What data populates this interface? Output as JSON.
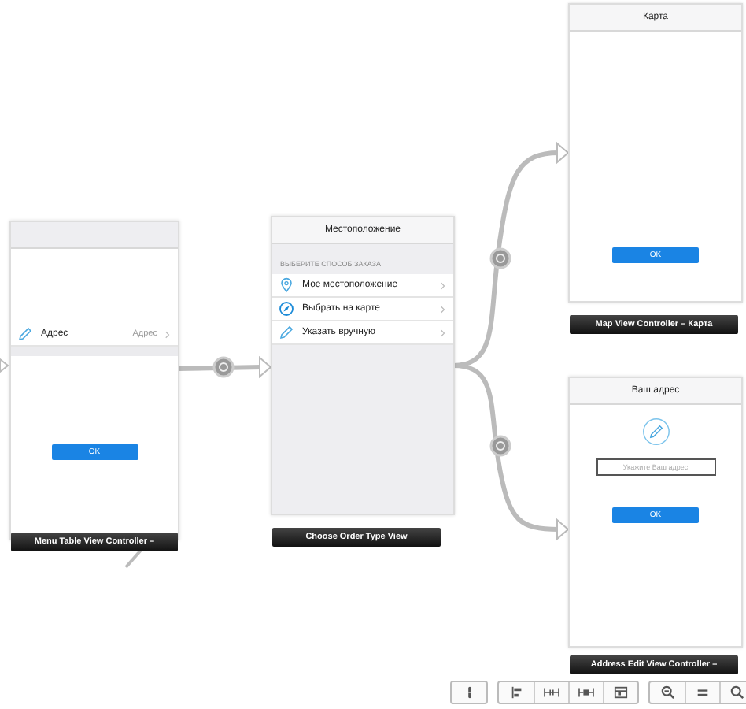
{
  "menu_scene": {
    "rows": [
      {
        "label": "Адрес",
        "detail": "Адрес"
      }
    ],
    "button": "OK",
    "caption": "Menu Table View Controller –"
  },
  "order_scene": {
    "title": "Местоположение",
    "section": "ВЫБЕРИТЕ СПОСОБ ЗАКАЗА",
    "rows": [
      {
        "label": "Мое местоположение"
      },
      {
        "label": "Выбрать на карте"
      },
      {
        "label": "Указать вручную"
      }
    ],
    "caption": "Choose Order Type View"
  },
  "map_scene": {
    "title": "Карта",
    "button": "OK",
    "caption": "Map View Controller – Карта"
  },
  "address_scene": {
    "title": "Ваш адрес",
    "placeholder": "Укажите Ваш адрес",
    "button": "OK",
    "caption": "Address Edit View Controller –"
  }
}
